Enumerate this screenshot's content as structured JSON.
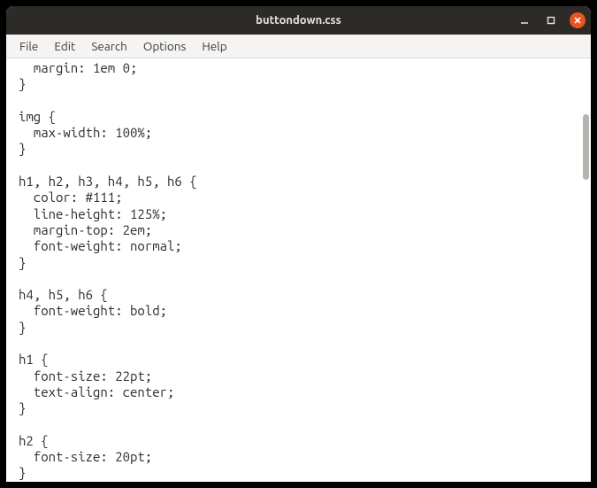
{
  "window": {
    "title": "buttondown.css"
  },
  "menu": {
    "file": "File",
    "edit": "Edit",
    "search": "Search",
    "options": "Options",
    "help": "Help"
  },
  "editor": {
    "lines": [
      "  margin: 1em 0;",
      "}",
      "",
      "img {",
      "  max-width: 100%;",
      "}",
      "",
      "h1, h2, h3, h4, h5, h6 {",
      "  color: #111;",
      "  line-height: 125%;",
      "  margin-top: 2em;",
      "  font-weight: normal;",
      "}",
      "",
      "h4, h5, h6 {",
      "  font-weight: bold;",
      "}",
      "",
      "h1 {",
      "  font-size: 22pt;",
      "  text-align: center;",
      "}",
      "",
      "h2 {",
      "  font-size: 20pt;",
      "}"
    ]
  },
  "scroll": {
    "thumbTop": 63,
    "thumbHeight": 74
  }
}
